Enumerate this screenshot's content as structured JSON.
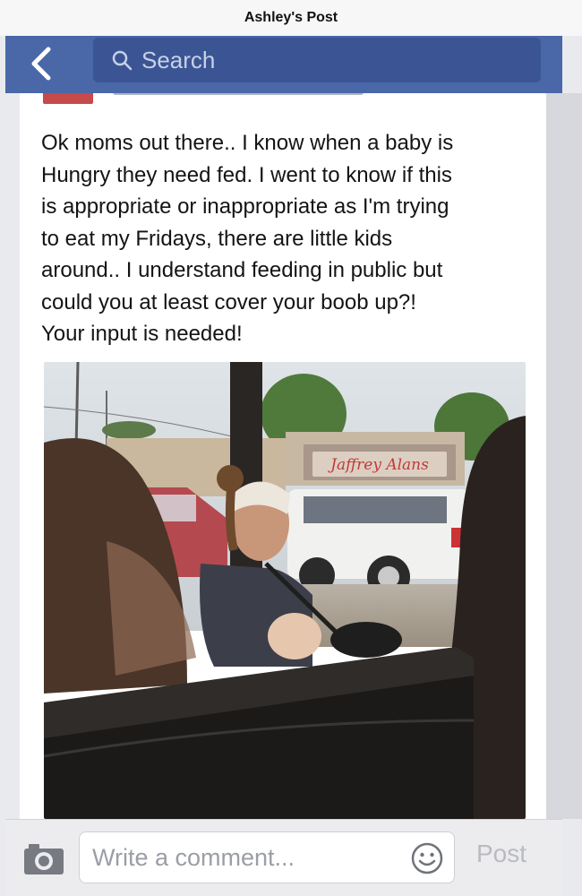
{
  "window": {
    "title": "Ashley's Post"
  },
  "nav": {
    "back_icon": "chevron-left-icon",
    "search_placeholder": "Search",
    "search_icon": "search-icon",
    "bar_color": "#4a67a8"
  },
  "post": {
    "text_lines": [
      "Ok moms out there.. I know when a baby is",
      "Hungry they need fed. I went to know if this",
      "is appropriate or inappropriate as I'm trying",
      "to eat my Fridays, there are little kids",
      "around.. I understand feeding in public but",
      "could you at least cover your boob up?!",
      "Your input is needed!"
    ],
    "photo": {
      "sign_text": "Jaffrey Alans"
    }
  },
  "composer": {
    "camera_icon": "camera-icon",
    "placeholder": "Write a comment...",
    "emoji_icon": "smiley-icon",
    "post_label": "Post"
  }
}
